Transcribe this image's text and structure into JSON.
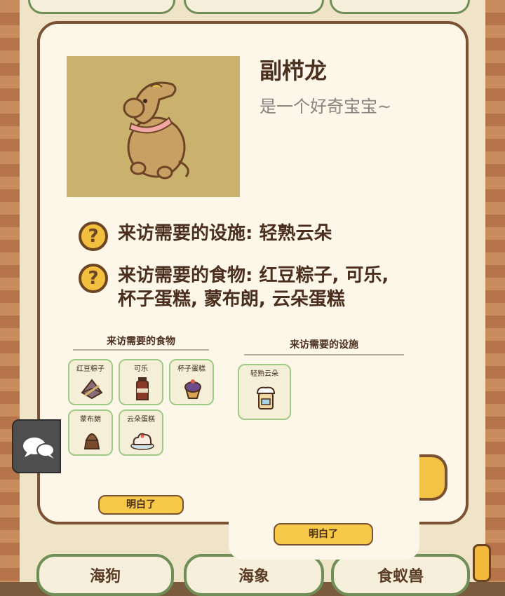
{
  "creature": {
    "name": "副栉龙",
    "description": "是一个好奇宝宝~"
  },
  "requirements": {
    "facility_line": "来访需要的设施: 轻熟云朵",
    "food_line_1": "来访需要的食物: 红豆粽子, 可乐,",
    "food_line_2": "杯子蛋糕, 蒙布朗, 云朵蛋糕"
  },
  "food_panel": {
    "title": "来访需要的食物",
    "items": [
      {
        "label": "红豆粽子",
        "icon": "zongzi-icon"
      },
      {
        "label": "可乐",
        "icon": "cola-icon"
      },
      {
        "label": "杯子蛋糕",
        "icon": "cupcake-icon"
      },
      {
        "label": "蒙布朗",
        "icon": "mont-blanc-icon"
      },
      {
        "label": "云朵蛋糕",
        "icon": "cloud-cake-icon"
      }
    ],
    "ok_label": "明白了"
  },
  "facility_panel": {
    "title": "来访需要的设施",
    "items": [
      {
        "label": "轻熟云朵",
        "icon": "cloud-oven-icon"
      }
    ],
    "ok_label": "明白了"
  },
  "background": {
    "bottom_cards": [
      "海狗",
      "海象",
      "食蚁兽"
    ]
  },
  "colors": {
    "modal_bg": "#fdf7ea",
    "border_brown": "#7a5132",
    "accent_yellow": "#f3bf3e",
    "item_border_green": "#9fcb86"
  }
}
